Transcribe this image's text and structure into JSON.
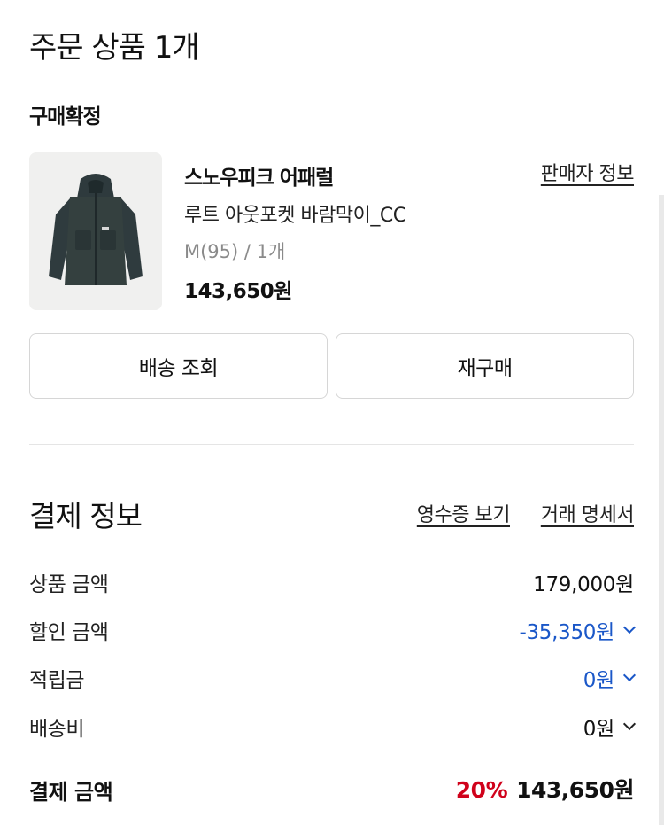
{
  "order": {
    "title": "주문 상품 1개",
    "status": "구매확정"
  },
  "product": {
    "brand": "스노우피크 어패럴",
    "name": "루트 아웃포켓 바람막이_CC",
    "option": "M(95) / 1개",
    "price": "143,650원",
    "seller_link": "판매자 정보",
    "image_icon": "jacket-image"
  },
  "actions": {
    "shipping_label": "배송 조회",
    "rebuy_label": "재구매"
  },
  "payment": {
    "title": "결제 정보",
    "receipt_link": "영수증 보기",
    "statement_link": "거래 명세서",
    "rows": [
      {
        "label": "상품 금액",
        "value": "179,000원"
      },
      {
        "label": "할인 금액",
        "value": "-35,350원"
      },
      {
        "label": "적립금",
        "value": "0원"
      },
      {
        "label": "배송비",
        "value": "0원"
      }
    ],
    "total_label": "결제 금액",
    "discount_rate": "20%",
    "total_value": "143,650원"
  },
  "colors": {
    "accent_blue": "#1a57c8",
    "discount_red": "#d0021b"
  }
}
